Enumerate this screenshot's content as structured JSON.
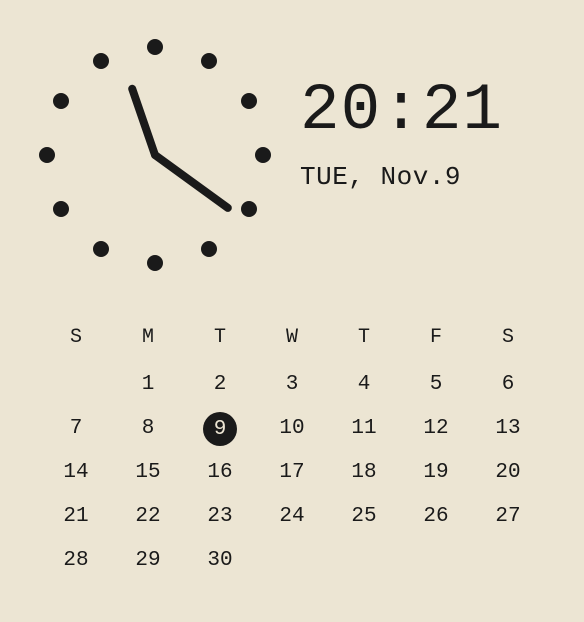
{
  "colors": {
    "bg": "#ece5d3",
    "fg": "#1a1a1a"
  },
  "clock": {
    "dot_count": 12,
    "time_text": "20:21",
    "date_text": "TUE, Nov.9",
    "hour_angle_deg": 251,
    "minute_angle_deg": 36
  },
  "calendar": {
    "day_headers": [
      "S",
      "M",
      "T",
      "W",
      "T",
      "F",
      "S"
    ],
    "weeks": [
      [
        "",
        "1",
        "2",
        "3",
        "4",
        "5",
        "6"
      ],
      [
        "7",
        "8",
        "9",
        "10",
        "11",
        "12",
        "13"
      ],
      [
        "14",
        "15",
        "16",
        "17",
        "18",
        "19",
        "20"
      ],
      [
        "21",
        "22",
        "23",
        "24",
        "25",
        "26",
        "27"
      ],
      [
        "28",
        "29",
        "30",
        "",
        "",
        "",
        ""
      ]
    ],
    "today": "9"
  }
}
